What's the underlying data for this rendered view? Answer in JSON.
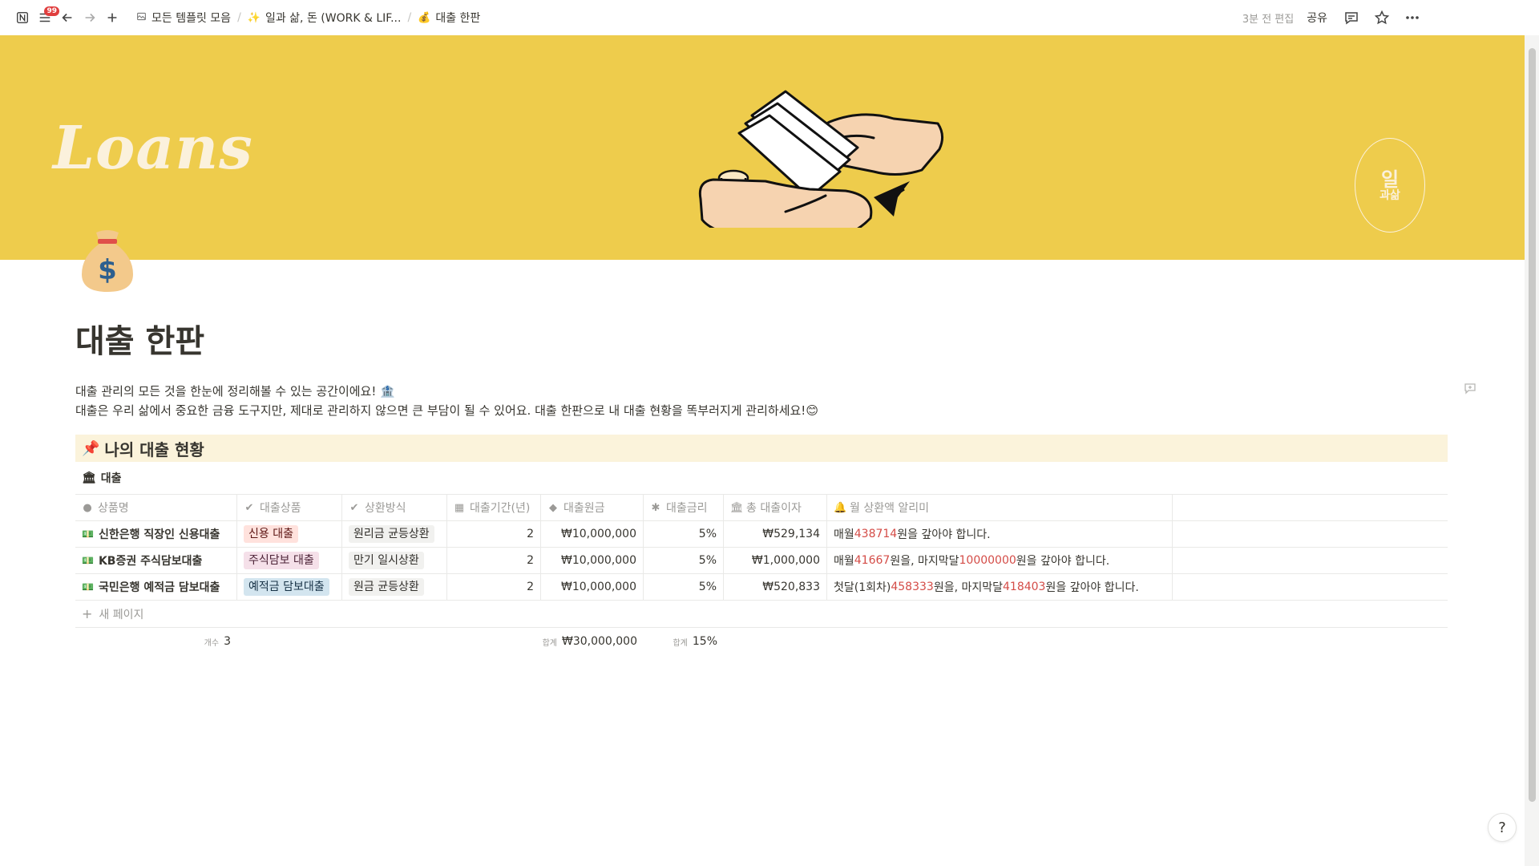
{
  "topbar": {
    "notification_count": "99",
    "breadcrumbs": [
      {
        "icon": "template-icon",
        "label": "모든 템플릿 모음"
      },
      {
        "icon": "sparkle-icon",
        "emoji": "✨",
        "label": "일과 삶, 돈 (WORK & LIF..."
      },
      {
        "icon": "moneybag-icon",
        "emoji": "💰",
        "label": "대출 한판"
      }
    ],
    "separator": "/",
    "edited": "3분 전 편집",
    "share_label": "공유"
  },
  "cover": {
    "title": "Loans",
    "seal_line1": "일",
    "seal_line2": "과삶",
    "background": "#eecc4c"
  },
  "page": {
    "title": "대출 한판",
    "description_line1": "대출 관리의 모든 것을 한눈에 정리해볼 수 있는 공간이에요! 🏦",
    "description_line2": "대출은 우리 삶에서 중요한 금융 도구지만, 제대로 관리하지 않으면 큰 부담이 될 수 있어요. 대출 한판으로 내 대출 현황을 똑부러지게 관리하세요!😊"
  },
  "callout": {
    "emoji": "📌",
    "text": "나의 대출 현황"
  },
  "database": {
    "emoji": "🏛",
    "title": "대출",
    "columns": [
      {
        "icon": "●",
        "label": "상품명"
      },
      {
        "icon": "✔",
        "label": "대출상품"
      },
      {
        "icon": "✔",
        "label": "상환방식"
      },
      {
        "icon": "▦",
        "label": "대출기간(년)"
      },
      {
        "icon": "◆",
        "label": "대출원금"
      },
      {
        "icon": "✱",
        "label": "대출금리"
      },
      {
        "icon": "🏛",
        "label": "총 대출이자"
      },
      {
        "icon": "🔔",
        "label": "월 상환액 알리미"
      }
    ],
    "rows": [
      {
        "emoji": "💵",
        "name": "신한은행 직장인 신용대출",
        "product": "신용 대출",
        "product_color": "red",
        "method": "원리금 균등상환",
        "period": "2",
        "principal": "₩10,000,000",
        "rate": "5%",
        "interest": "₩529,134",
        "alarm_pre": "매월 ",
        "alarm_v1": "438714",
        "alarm_mid": "원을 갚아야 합니다.",
        "alarm_v2": "",
        "alarm_post": ""
      },
      {
        "emoji": "💵",
        "name": "KB증권 주식담보대출",
        "product": "주식담보 대출",
        "product_color": "pink",
        "method": "만기 일시상환",
        "period": "2",
        "principal": "₩10,000,000",
        "rate": "5%",
        "interest": "₩1,000,000",
        "alarm_pre": "매월 ",
        "alarm_v1": "41667",
        "alarm_mid": "원을, 마지막달 ",
        "alarm_v2": "10000000",
        "alarm_post": "원을 갚아야 합니다."
      },
      {
        "emoji": "💵",
        "name": "국민은행 예적금 담보대출",
        "product": "예적금 담보대출",
        "product_color": "blue",
        "method": "원금 균등상환",
        "period": "2",
        "principal": "₩10,000,000",
        "rate": "5%",
        "interest": "₩520,833",
        "alarm_pre": "첫달(1회차) ",
        "alarm_v1": "458333",
        "alarm_mid": "원을, 마지막달 ",
        "alarm_v2": "418403",
        "alarm_post": "원을 갚아야 합니다."
      }
    ],
    "new_page_label": "새 페이지",
    "footer": {
      "count_label": "개수",
      "count_value": "3",
      "sum_label": "합계",
      "principal_sum": "₩30,000,000",
      "rate_sum_label": "합계",
      "rate_sum": "15%"
    }
  },
  "help_label": "?"
}
